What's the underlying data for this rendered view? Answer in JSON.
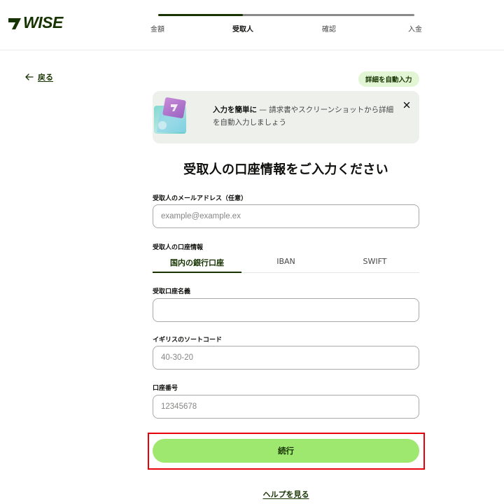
{
  "brand": {
    "name": "WISE",
    "color": "#163300",
    "accent": "#9fe870"
  },
  "progress": {
    "steps": [
      "金額",
      "受取人",
      "確認",
      "入金"
    ],
    "active_index": 1,
    "completed_fraction": 0.33
  },
  "nav": {
    "back_label": "戻る"
  },
  "autofill": {
    "pill_label": "詳細を自動入力"
  },
  "banner": {
    "title": "入力を簡単に",
    "text": " — 請求書やスクリーンショットから詳細を自動入力しましょう",
    "close_icon": "close-icon"
  },
  "form": {
    "title": "受取人の口座情報をご入力ください",
    "email": {
      "label": "受取人のメールアドレス（任意）",
      "placeholder": "example@example.ex",
      "value": ""
    },
    "account_section_label": "受取人の口座情報",
    "tabs": [
      {
        "label": "国内の銀行口座",
        "active": true
      },
      {
        "label": "IBAN",
        "active": false
      },
      {
        "label": "SWIFT",
        "active": false
      }
    ],
    "account_name": {
      "label": "受取口座名義",
      "placeholder": "",
      "value": ""
    },
    "sort_code": {
      "label": "イギリスのソートコード",
      "placeholder": "40-30-20",
      "value": ""
    },
    "account_number": {
      "label": "口座番号",
      "placeholder": "12345678",
      "value": ""
    },
    "continue_label": "続行"
  },
  "footer": {
    "help_label": "ヘルプを見る"
  }
}
